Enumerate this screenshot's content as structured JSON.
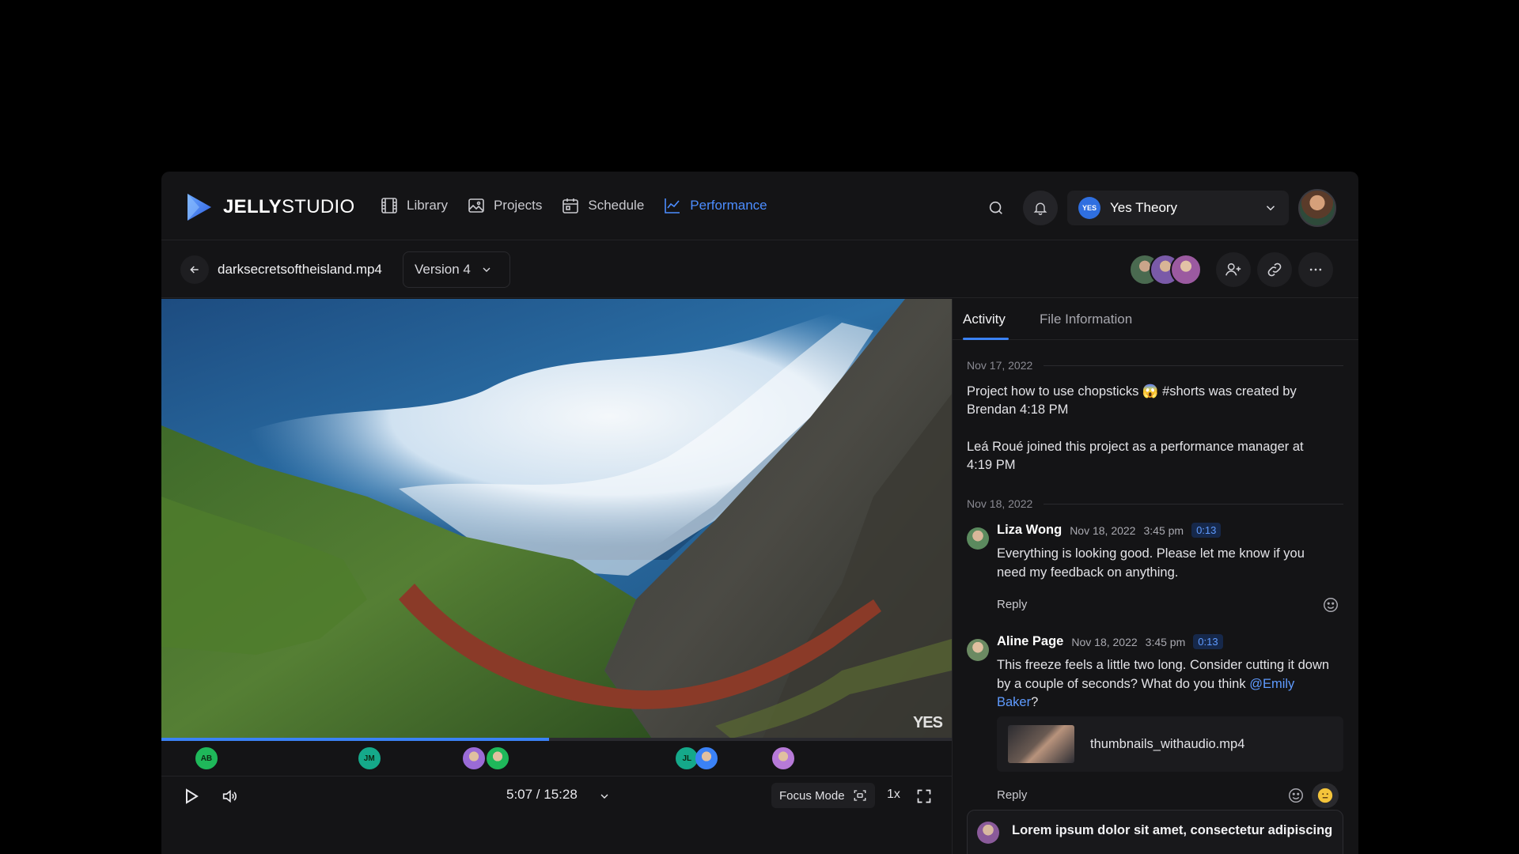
{
  "app": {
    "logo_bold": "JELLY",
    "logo_light": "STUDIO",
    "accent": "#3b82f6"
  },
  "nav": [
    {
      "label": "Library",
      "icon": "film-icon"
    },
    {
      "label": "Projects",
      "icon": "image-icon"
    },
    {
      "label": "Schedule",
      "icon": "calendar-icon"
    },
    {
      "label": "Performance",
      "icon": "chart-icon",
      "active": true
    }
  ],
  "workspace": {
    "badge": "YES",
    "name": "Yes Theory"
  },
  "file": {
    "name": "darksecretsoftheisland.mp4",
    "version": "Version 4"
  },
  "video": {
    "watermark": "YES",
    "current_time": "5:07",
    "duration": "15:28",
    "time_display": "5:07 / 15:28",
    "progress": 0.49,
    "focus_mode_label": "Focus Mode",
    "speed": "1x",
    "markers": [
      {
        "initials": "AB",
        "color": "#1fb85a",
        "position": 0.057
      },
      {
        "initials": "JM",
        "color": "#15a98a",
        "position": 0.263
      },
      {
        "initials": "",
        "color": "#9a6bd6",
        "position": 0.395
      },
      {
        "initials": "",
        "color": "#1fb85a",
        "position": 0.425
      },
      {
        "initials": "JL",
        "color": "#15a98a",
        "position": 0.665
      },
      {
        "initials": "",
        "color": "#3b82f6",
        "position": 0.69
      },
      {
        "initials": "",
        "color": "#b77ad8",
        "position": 0.787
      }
    ]
  },
  "panel": {
    "tabs": [
      "Activity",
      "File Information"
    ],
    "active_tab": "Activity",
    "date1": "Nov 17, 2022",
    "log1": "Project how to use chopsticks 😱 #shorts was created by Brendan 4:18 PM",
    "log2": "Leá Roué joined this project as a performance manager at 4:19 PM",
    "date2": "Nov 18, 2022",
    "comments": [
      {
        "author": "Liza Wong",
        "date": "Nov 18, 2022",
        "time": "3:45 pm",
        "stamp": "0:13",
        "text": "Everything is looking good. Please let me know if you need my feedback on anything.",
        "reply": "Reply"
      },
      {
        "author": "Aline Page",
        "date": "Nov 18, 2022",
        "time": "3:45 pm",
        "stamp": "0:13",
        "text_before": "This freeze feels a little two long. Consider cutting it down by a couple of seconds? What do you think ",
        "mention": "@Emily Baker",
        "text_after": "?",
        "attachment": "thumbnails_withaudio.mp4",
        "reply": "Reply"
      }
    ],
    "composer_preview": "Lorem ipsum dolor sit amet, consectetur adipiscing"
  }
}
